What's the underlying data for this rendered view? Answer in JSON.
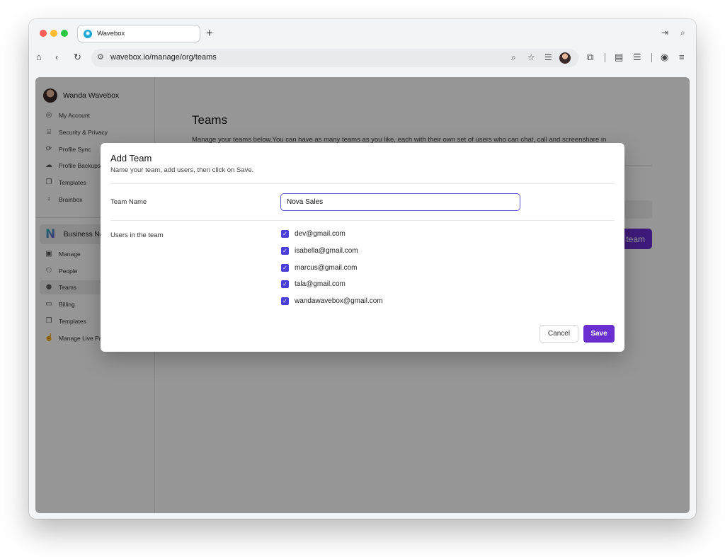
{
  "browser": {
    "tab_title": "Wavebox",
    "new_tab_glyph": "+",
    "url": "wavebox.io/manage/org/teams"
  },
  "sidebar": {
    "user_name": "Wanda Wavebox",
    "account_items": [
      {
        "label": "My Account",
        "icon": "user-circle-icon"
      },
      {
        "label": "Security & Privacy",
        "icon": "lock-icon"
      },
      {
        "label": "Profile Sync",
        "icon": "sync-icon"
      },
      {
        "label": "Profile Backups",
        "icon": "cloud-icon"
      },
      {
        "label": "Templates",
        "icon": "copy-icon"
      },
      {
        "label": "Brainbox",
        "icon": "lightbulb-icon"
      }
    ],
    "org_name": "Business Nar",
    "org_items": [
      {
        "label": "Manage",
        "icon": "id-card-icon"
      },
      {
        "label": "People",
        "icon": "add-person-icon"
      },
      {
        "label": "Teams",
        "icon": "group-icon",
        "active": true
      },
      {
        "label": "Billing",
        "icon": "credit-card-icon"
      },
      {
        "label": "Templates",
        "icon": "copy-icon"
      },
      {
        "label": "Manage Live Pre",
        "icon": "touch-icon"
      }
    ]
  },
  "page": {
    "title": "Teams",
    "description": "Manage your teams below.You can have as many teams as you like, each with their own set of users who can chat, call and screenshare in",
    "add_team_button": "team"
  },
  "modal": {
    "title": "Add Team",
    "subtitle": "Name your team, add users, then click on Save.",
    "team_name_label": "Team Name",
    "team_name_value": "Nova Sales",
    "users_label": "Users in the team",
    "users": [
      {
        "email": "dev@gmail.com",
        "checked": true
      },
      {
        "email": "isabella@gmail.com",
        "checked": true
      },
      {
        "email": "marcus@gmail.com",
        "checked": true
      },
      {
        "email": "tala@gmail.com",
        "checked": true
      },
      {
        "email": "wandawavebox@gmail.com",
        "checked": true
      }
    ],
    "cancel_label": "Cancel",
    "save_label": "Save"
  },
  "colors": {
    "accent": "#6a2fd0",
    "checkbox": "#4a3fd8",
    "input_border": "#5b57d8",
    "overlay": "rgba(0,0,0,0.41)"
  }
}
